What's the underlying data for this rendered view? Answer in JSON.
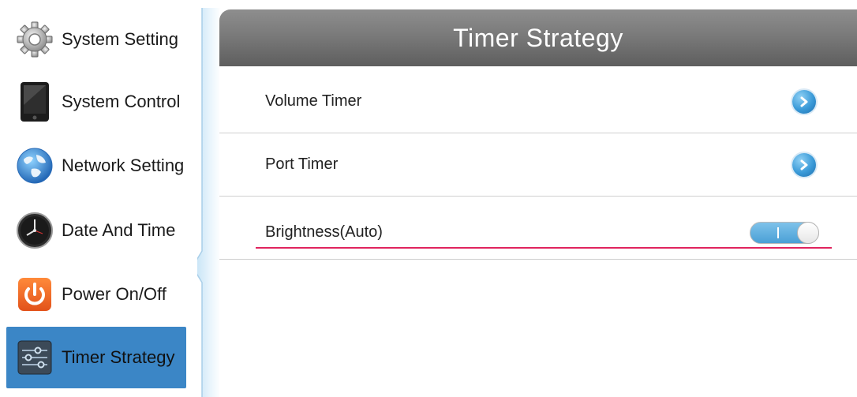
{
  "sidebar": {
    "items": [
      {
        "label": "System Setting",
        "icon": "gear-icon"
      },
      {
        "label": "System Control",
        "icon": "tablet-icon"
      },
      {
        "label": "Network Setting",
        "icon": "globe-icon"
      },
      {
        "label": "Date And Time",
        "icon": "clock-icon"
      },
      {
        "label": "Power On/Off",
        "icon": "power-icon"
      },
      {
        "label": "Timer Strategy",
        "icon": "sliders-icon",
        "active": true
      }
    ]
  },
  "main": {
    "title": "Timer Strategy",
    "rows": [
      {
        "label": "Volume Timer",
        "control": "chevron-right-icon"
      },
      {
        "label": "Port Timer",
        "control": "chevron-right-icon"
      },
      {
        "label": "Brightness(Auto)",
        "control": "toggle",
        "toggle_on": true
      }
    ]
  },
  "colors": {
    "accent": "#3b86c6",
    "header": "#7a7a7a",
    "focus_underline": "#e0245e",
    "toggle_on": "#4aa0d6"
  }
}
